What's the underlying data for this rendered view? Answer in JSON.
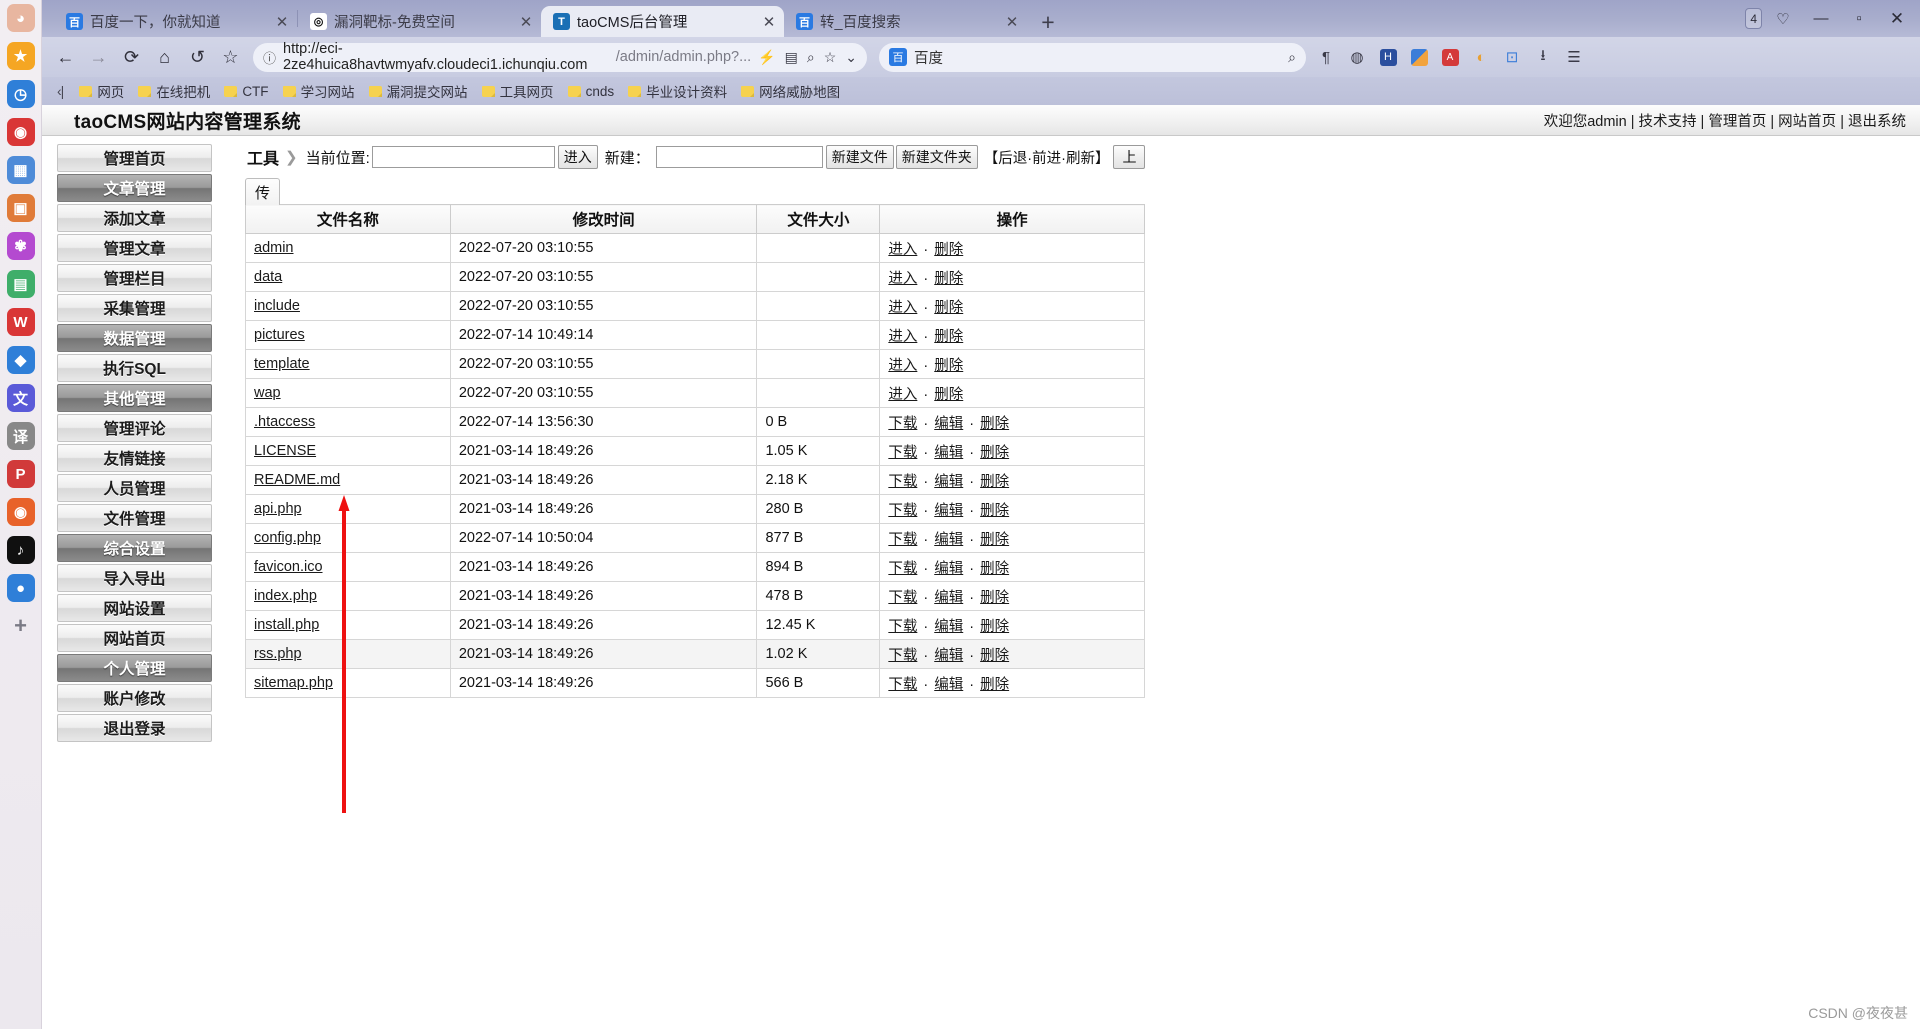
{
  "os_rail": {
    "icons": [
      {
        "name": "user-avatar",
        "glyph": "◕",
        "color": "#e8b6a0"
      },
      {
        "name": "bookmark-star-icon",
        "glyph": "★",
        "color": "#f5a623"
      },
      {
        "name": "clock-icon",
        "glyph": "◷",
        "color": "#2f7fd8"
      },
      {
        "name": "record-icon",
        "glyph": "◉",
        "color": "#d93636"
      },
      {
        "name": "apps-grid-icon",
        "glyph": "▦",
        "color": "#4e8bd8"
      },
      {
        "name": "image-icon",
        "glyph": "▣",
        "color": "#e07b39"
      },
      {
        "name": "octopus-icon",
        "glyph": "✾",
        "color": "#b44ad0"
      },
      {
        "name": "note-icon",
        "glyph": "▤",
        "color": "#3fae6a"
      },
      {
        "name": "wps-icon",
        "glyph": "W",
        "color": "#d93636"
      },
      {
        "name": "feishu-icon",
        "glyph": "◆",
        "color": "#2f7fd8"
      },
      {
        "name": "translate-icon",
        "glyph": "文",
        "color": "#5a5ad8"
      },
      {
        "name": "yi-icon",
        "glyph": "译",
        "color": "#888888"
      },
      {
        "name": "pinterest-icon",
        "glyph": "P",
        "color": "#d13a3a"
      },
      {
        "name": "firefox-icon",
        "glyph": "◉",
        "color": "#e8622a"
      },
      {
        "name": "tiktok-icon",
        "glyph": "♪",
        "color": "#101010"
      },
      {
        "name": "blue-dot-icon",
        "glyph": "●",
        "color": "#2f7fd8"
      },
      {
        "name": "add-icon",
        "glyph": "+",
        "color": "#7a7a85"
      }
    ]
  },
  "browser": {
    "tabs": [
      {
        "title": "百度一下，你就知道",
        "favicon": "baidu-favicon",
        "favicon_glyph": "百",
        "favicon_color": "#2a7ae2",
        "active": false
      },
      {
        "title": "漏洞靶标-免费空间",
        "favicon": "target-favicon",
        "favicon_glyph": "◎",
        "favicon_color": "#ffffff",
        "active": false
      },
      {
        "title": "taoCMS后台管理",
        "favicon": "taocms-favicon",
        "favicon_glyph": "T",
        "favicon_color": "#1a6fb5",
        "active": true
      },
      {
        "title": "转_百度搜索",
        "favicon": "baidu-favicon",
        "favicon_glyph": "百",
        "favicon_color": "#2a7ae2",
        "active": false
      }
    ],
    "new_tab_glyph": "+",
    "account_badge": "4",
    "window_controls": {
      "minimize": "—",
      "maximize": "▫",
      "close": "✕"
    },
    "toolbar": {
      "back": "←",
      "forward": "→",
      "reload": "⟳",
      "home": "⌂",
      "undo": "↺",
      "favorite": "☆",
      "url_prefix": "http://eci-2ze4huica8havtwmyafv.cloudeci1.ichunqiu.com",
      "url_path": "/admin/admin.php?...",
      "site_info_icon": "ⓘ",
      "omni_right": [
        "⚡",
        "▦",
        "🔍",
        "☆",
        "⌄"
      ],
      "search_placeholder": "百度",
      "search_icon": "search-icon",
      "extensions": [
        "¶",
        "◍",
        "H",
        "▦",
        "A",
        "◐",
        "⊡",
        "⭳",
        "☰"
      ]
    },
    "bookmarks": {
      "collapse": "‹|",
      "items": [
        "网页",
        "在线把机",
        "CTF",
        "学习网站",
        "漏洞提交网站",
        "工具网页",
        "cnds",
        "毕业设计资料",
        "网络威胁地图"
      ]
    }
  },
  "cms": {
    "title": "taoCMS网站内容管理系统",
    "header_links": "欢迎您admin | 技术支持 | 管理首页 | 网站首页 | 退出系统",
    "sidebar": [
      {
        "label": "管理首页",
        "section": false
      },
      {
        "label": "文章管理",
        "section": true
      },
      {
        "label": "添加文章",
        "section": false
      },
      {
        "label": "管理文章",
        "section": false
      },
      {
        "label": "管理栏目",
        "section": false
      },
      {
        "label": "采集管理",
        "section": false
      },
      {
        "label": "数据管理",
        "section": true
      },
      {
        "label": "执行SQL",
        "section": false
      },
      {
        "label": "其他管理",
        "section": true
      },
      {
        "label": "管理评论",
        "section": false
      },
      {
        "label": "友情链接",
        "section": false
      },
      {
        "label": "人员管理",
        "section": false
      },
      {
        "label": "文件管理",
        "section": false
      },
      {
        "label": "综合设置",
        "section": true
      },
      {
        "label": "导入导出",
        "section": false
      },
      {
        "label": "网站设置",
        "section": false
      },
      {
        "label": "网站首页",
        "section": false
      },
      {
        "label": "个人管理",
        "section": true
      },
      {
        "label": "账户修改",
        "section": false
      },
      {
        "label": "退出登录",
        "section": false
      }
    ],
    "toolbar": {
      "tools_label": "工具",
      "chevron": "❯",
      "position_label": "当前位置:",
      "position_value": "",
      "enter_button": "进入",
      "new_label": "新建：",
      "new_value": "",
      "new_file_button": "新建文件",
      "new_folder_button": "新建文件夹",
      "nav_info": "【后退·前进·刷新】",
      "up_button": "上"
    },
    "table": {
      "inner_tab": "传",
      "columns": [
        "文件名称",
        "修改时间",
        "文件大小",
        "操作"
      ],
      "action_enter": "进入",
      "action_download": "下载",
      "action_edit": "编辑",
      "action_delete": "删除",
      "rows": [
        {
          "name": "admin",
          "time": "2022-07-20 03:10:55",
          "size": "",
          "type": "dir"
        },
        {
          "name": "data",
          "time": "2022-07-20 03:10:55",
          "size": "",
          "type": "dir"
        },
        {
          "name": "include",
          "time": "2022-07-20 03:10:55",
          "size": "",
          "type": "dir"
        },
        {
          "name": "pictures",
          "time": "2022-07-14 10:49:14",
          "size": "",
          "type": "dir"
        },
        {
          "name": "template",
          "time": "2022-07-20 03:10:55",
          "size": "",
          "type": "dir"
        },
        {
          "name": "wap",
          "time": "2022-07-20 03:10:55",
          "size": "",
          "type": "dir"
        },
        {
          "name": ".htaccess",
          "time": "2022-07-14 13:56:30",
          "size": "0 B",
          "type": "file"
        },
        {
          "name": "LICENSE",
          "time": "2021-03-14 18:49:26",
          "size": "1.05 K",
          "type": "file"
        },
        {
          "name": "README.md",
          "time": "2021-03-14 18:49:26",
          "size": "2.18 K",
          "type": "file"
        },
        {
          "name": "api.php",
          "time": "2021-03-14 18:49:26",
          "size": "280 B",
          "type": "file"
        },
        {
          "name": "config.php",
          "time": "2022-07-14 10:50:04",
          "size": "877 B",
          "type": "file"
        },
        {
          "name": "favicon.ico",
          "time": "2021-03-14 18:49:26",
          "size": "894 B",
          "type": "file"
        },
        {
          "name": "index.php",
          "time": "2021-03-14 18:49:26",
          "size": "478 B",
          "type": "file"
        },
        {
          "name": "install.php",
          "time": "2021-03-14 18:49:26",
          "size": "12.45 K",
          "type": "file"
        },
        {
          "name": "rss.php",
          "time": "2021-03-14 18:49:26",
          "size": "1.02 K",
          "type": "file"
        },
        {
          "name": "sitemap.php",
          "time": "2021-03-14 18:49:26",
          "size": "566 B",
          "type": "file"
        }
      ]
    }
  },
  "annotation": {
    "arrow_color": "#ee1111"
  },
  "watermark": "CSDN @夜夜甚"
}
